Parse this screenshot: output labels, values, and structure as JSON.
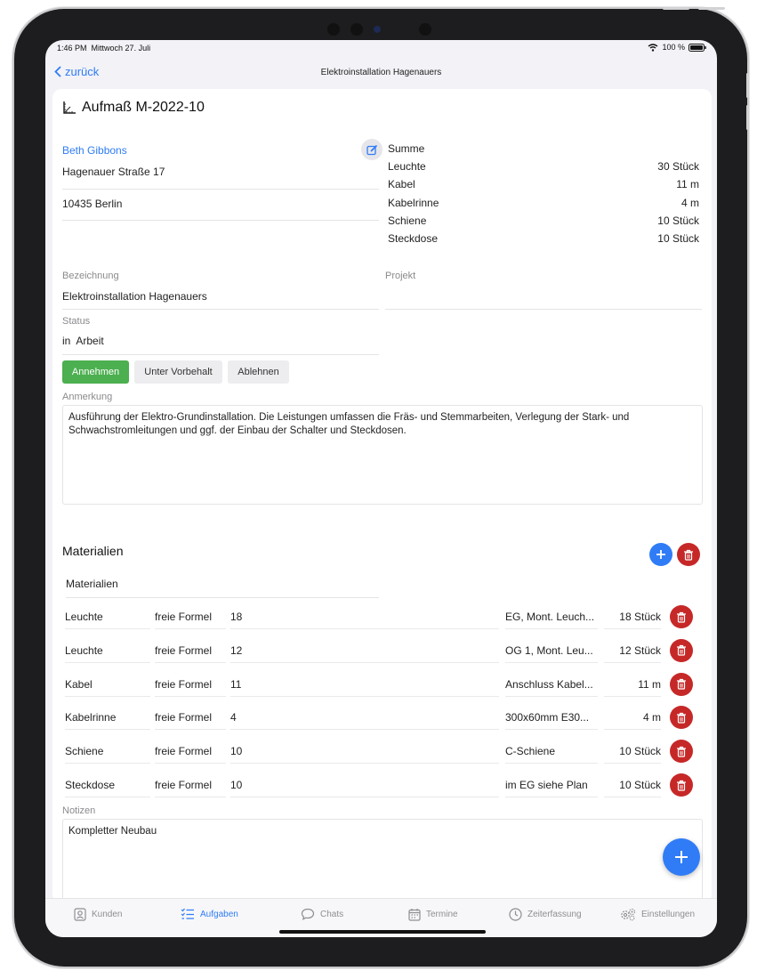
{
  "statusbar": {
    "time": "1:46 PM",
    "date": "Mittwoch 27. Juli",
    "battery": "100 %"
  },
  "nav": {
    "back_label": "zurück",
    "title": "Elektroinstallation Hagenauers"
  },
  "header": {
    "title": "Aufmaß M-2022-10"
  },
  "customer": {
    "name": "Beth Gibbons",
    "street": "Hagenauer Straße 17",
    "city": "10435 Berlin"
  },
  "summary": {
    "title": "Summe",
    "rows": [
      {
        "label": "Leuchte",
        "value": "30 Stück"
      },
      {
        "label": "Kabel",
        "value": "11 m"
      },
      {
        "label": "Kabelrinne",
        "value": "4 m"
      },
      {
        "label": "Schiene",
        "value": "10 Stück"
      },
      {
        "label": "Steckdose",
        "value": "10 Stück"
      }
    ]
  },
  "fields": {
    "bezeichnung_label": "Bezeichnung",
    "bezeichnung_value": "Elektroinstallation Hagenauers",
    "projekt_label": "Projekt",
    "projekt_value": "",
    "status_label": "Status",
    "status_value": "in  Arbeit"
  },
  "actions": {
    "accept": "Annehmen",
    "reserve": "Unter Vorbehalt",
    "reject": "Ablehnen"
  },
  "remark": {
    "label": "Anmerkung",
    "text": "Ausführung der Elektro-Grundinstallation. Die Leistungen umfassen die Fräs- und Stemmarbeiten, Verlegung der Stark- und Schwachstromleitungen und ggf. der Einbau der Schalter und Steckdosen."
  },
  "materials": {
    "section_title": "Materialien",
    "list_label": "Materialien",
    "rows": [
      {
        "name": "Leuchte",
        "formula": "freie Formel",
        "input": "18",
        "note": "EG, Mont. Leuch...",
        "qty": "18 Stück"
      },
      {
        "name": "Leuchte",
        "formula": "freie Formel",
        "input": "12",
        "note": "OG 1, Mont. Leu...",
        "qty": "12 Stück"
      },
      {
        "name": "Kabel",
        "formula": "freie Formel",
        "input": "11",
        "note": "Anschluss Kabel...",
        "qty": "11 m"
      },
      {
        "name": "Kabelrinne",
        "formula": "freie Formel",
        "input": "4",
        "note": "300x60mm E30...",
        "qty": "4 m"
      },
      {
        "name": "Schiene",
        "formula": "freie Formel",
        "input": "10",
        "note": "C-Schiene",
        "qty": "10 Stück"
      },
      {
        "name": "Steckdose",
        "formula": "freie Formel",
        "input": "10",
        "note": "im EG siehe Plan",
        "qty": "10 Stück"
      }
    ]
  },
  "notes": {
    "label": "Notizen",
    "text": "Kompletter Neubau"
  },
  "tabs": [
    {
      "label": "Kunden",
      "icon": "person-icon"
    },
    {
      "label": "Aufgaben",
      "icon": "list-icon"
    },
    {
      "label": "Chats",
      "icon": "chat-icon"
    },
    {
      "label": "Termine",
      "icon": "calendar-icon"
    },
    {
      "label": "Zeiterfassung",
      "icon": "clock-icon"
    },
    {
      "label": "Einstellungen",
      "icon": "gears-icon"
    }
  ],
  "active_tab": "Aufgaben",
  "colors": {
    "accent": "#2f7cf6",
    "accept_green": "#4caf50",
    "delete_red": "#c62828"
  }
}
